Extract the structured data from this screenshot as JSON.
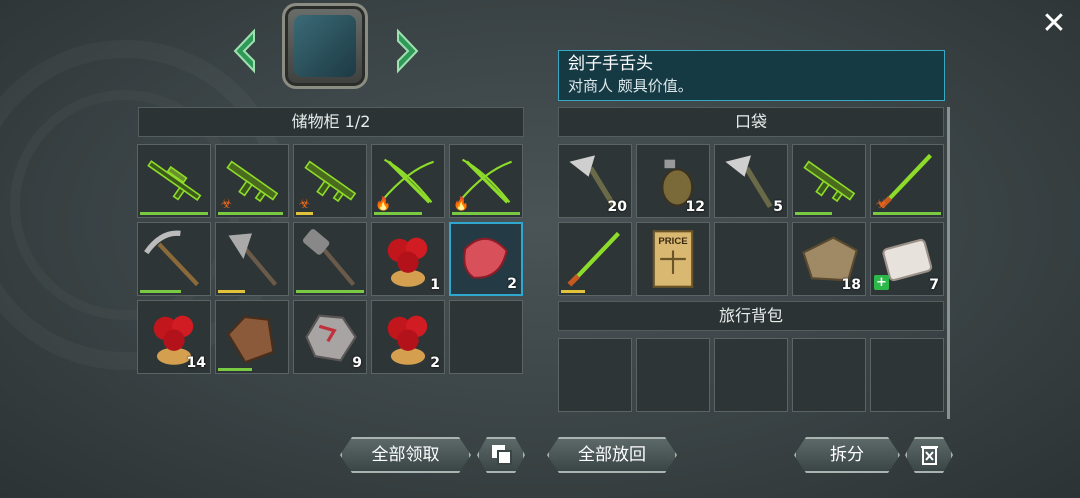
{
  "close": {
    "icon": "close-icon",
    "glyph": "✕"
  },
  "container": {
    "icon": "locker-cabinet-icon"
  },
  "locker": {
    "title": "储物柜 1/2"
  },
  "pocket": {
    "title": "口袋"
  },
  "backpack": {
    "title": "旅行背包"
  },
  "info": {
    "title": "刽子手舌头",
    "desc": "对商人 颇具价值。"
  },
  "locker_items": [
    {
      "icon": "sniper-rifle-icon",
      "count": "",
      "durability": 1.0,
      "dur_color": "#7ac943",
      "badge": ""
    },
    {
      "icon": "assault-rifle-icon",
      "count": "",
      "durability": 0.95,
      "dur_color": "#7ac943",
      "badge": "biohazard"
    },
    {
      "icon": "assault-rifle-icon",
      "count": "",
      "durability": 0.25,
      "dur_color": "#e2c23a",
      "badge": "biohazard"
    },
    {
      "icon": "crossbow-icon",
      "count": "",
      "durability": 0.7,
      "dur_color": "#7ac943",
      "badge": "fire"
    },
    {
      "icon": "crossbow-icon",
      "count": "",
      "durability": 1.0,
      "dur_color": "#7ac943",
      "badge": "fire"
    },
    {
      "icon": "pickaxe-icon",
      "count": "",
      "durability": 0.6,
      "dur_color": "#7ac943",
      "badge": ""
    },
    {
      "icon": "battle-axe-icon",
      "count": "",
      "durability": 0.4,
      "dur_color": "#e2c23a",
      "badge": ""
    },
    {
      "icon": "mace-icon",
      "count": "",
      "durability": 1.0,
      "dur_color": "#7ac943",
      "badge": ""
    },
    {
      "icon": "infected-flesh-icon",
      "count": "1",
      "durability": null,
      "dur_color": "",
      "badge": ""
    },
    {
      "icon": "executioner-tongue-icon",
      "count": "2",
      "durability": null,
      "dur_color": "",
      "badge": "",
      "selected": true
    },
    {
      "icon": "infected-flesh-icon",
      "count": "14",
      "durability": null,
      "dur_color": "",
      "badge": ""
    },
    {
      "icon": "leather-armor-icon",
      "count": "",
      "durability": 0.5,
      "dur_color": "#7ac943",
      "badge": ""
    },
    {
      "icon": "ore-rock-icon",
      "count": "9",
      "durability": null,
      "dur_color": "",
      "badge": ""
    },
    {
      "icon": "infected-flesh-icon",
      "count": "2",
      "durability": null,
      "dur_color": "",
      "badge": ""
    },
    {
      "icon": "",
      "count": "",
      "durability": null,
      "dur_color": "",
      "badge": ""
    }
  ],
  "pocket_items": [
    {
      "icon": "throwing-axe-icon",
      "count": "20",
      "durability": null,
      "dur_color": "",
      "badge": ""
    },
    {
      "icon": "grenade-icon",
      "count": "12",
      "durability": null,
      "dur_color": "",
      "badge": ""
    },
    {
      "icon": "throwing-axe-icon",
      "count": "5",
      "durability": null,
      "dur_color": "",
      "badge": ""
    },
    {
      "icon": "assault-rifle-icon",
      "count": "",
      "durability": 0.55,
      "dur_color": "#7ac943",
      "badge": ""
    },
    {
      "icon": "katana-icon",
      "count": "",
      "durability": 1.0,
      "dur_color": "#7ac943",
      "badge": "biohazard"
    },
    {
      "icon": "katana-icon",
      "count": "",
      "durability": 0.35,
      "dur_color": "#e2c23a",
      "badge": ""
    },
    {
      "icon": "price-document-icon",
      "count": "",
      "durability": null,
      "dur_color": "",
      "badge": "",
      "label": "PRICE"
    },
    {
      "icon": "",
      "count": "",
      "durability": null,
      "dur_color": "",
      "badge": ""
    },
    {
      "icon": "cloth-scraps-icon",
      "count": "18",
      "durability": null,
      "dur_color": "",
      "badge": ""
    },
    {
      "icon": "bandage-icon",
      "count": "7",
      "durability": null,
      "dur_color": "",
      "badge": "medical"
    }
  ],
  "backpack_items": [
    {
      "icon": "",
      "count": ""
    },
    {
      "icon": "",
      "count": ""
    },
    {
      "icon": "",
      "count": ""
    },
    {
      "icon": "",
      "count": ""
    },
    {
      "icon": "",
      "count": ""
    }
  ],
  "buttons": {
    "take_all": "全部领取",
    "put_back_all": "全部放回",
    "split": "拆分",
    "stack_icon": "stack-merge-icon",
    "trash_icon": "trash-icon"
  },
  "colors": {
    "accent": "#2fa7cf",
    "info_bg": "#153a44",
    "weapon_glow": "#8edc2a"
  }
}
